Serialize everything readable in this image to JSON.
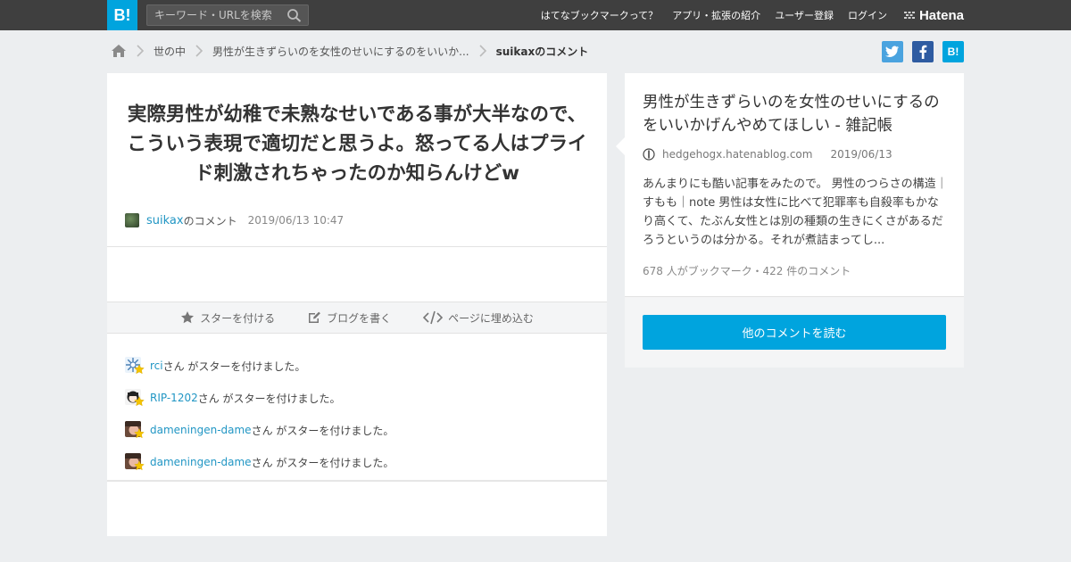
{
  "header": {
    "logo_text": "B!",
    "search_placeholder": "キーワード・URLを検索",
    "nav": [
      {
        "label": "はてなブックマークって？"
      },
      {
        "label": "アプリ・拡張の紹介"
      },
      {
        "label": "ユーザー登録"
      },
      {
        "label": "ログイン"
      }
    ],
    "brand": "Hatena"
  },
  "breadcrumb": {
    "items": [
      {
        "label": "世の中"
      },
      {
        "label": "男性が生きずらいのを女性のせいにするのをいいか..."
      }
    ],
    "current": "suikaxのコメント"
  },
  "share": {
    "hatena_label": "B!"
  },
  "comment": {
    "text": "実際男性が幼稚で未熟なせいである事が大半なので、こういう表現で適切だと思うよ。怒ってる人はプライド刺激されちゃったのか知らんけどw",
    "user": "suikax",
    "user_suffix": "のコメント",
    "date": "2019/06/13 10:47"
  },
  "actions": {
    "star": "スターを付ける",
    "blog": "ブログを書く",
    "embed": "ページに埋め込む"
  },
  "stars": {
    "suffix": "さん がスターを付けました。",
    "items": [
      {
        "user": "rci"
      },
      {
        "user": "RIP-1202"
      },
      {
        "user": "dameningen-dame"
      },
      {
        "user": "dameningen-dame"
      }
    ]
  },
  "entry": {
    "title": "男性が生きずらいのを女性のせいにするのをいいかげんやめてほしい - 雑記帳",
    "domain": "hedgehogx.hatenablog.com",
    "date": "2019/06/13",
    "summary": "あんまりにも酷い記事をみたので。 男性のつらさの構造｜すもも｜note 男性は女性に比べて犯罪率も自殺率もかなり高くて、たぶん女性とは別の種類の生きにくさがあるだろうというのは分かる。それが煮詰まってし...",
    "counts": "678 人がブックマーク・422 件のコメント",
    "read_button": "他のコメントを読む"
  },
  "colors": {
    "accent": "#00a4de",
    "header_bg": "#3f3f3f",
    "link": "#2196c4",
    "star": "#f5c400"
  }
}
